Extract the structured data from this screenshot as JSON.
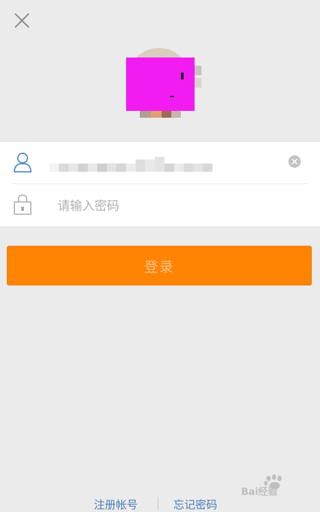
{
  "header": {
    "close_icon": "close-icon"
  },
  "avatar": {
    "icon": "avatar-image",
    "accent_color": "#f21cf2"
  },
  "form": {
    "username": {
      "icon": "user-icon",
      "value_obscured": true,
      "clear_icon": "clear-icon"
    },
    "password": {
      "icon": "lock-icon",
      "placeholder": "请输入密码",
      "value": ""
    }
  },
  "actions": {
    "login_label": "登录",
    "login_color": "#ff8404"
  },
  "footer": {
    "register_label": "注册帐号",
    "forgot_label": "忘记密码"
  },
  "watermark": {
    "text": "Bai经验",
    "icon": "baidu-paw-icon"
  }
}
